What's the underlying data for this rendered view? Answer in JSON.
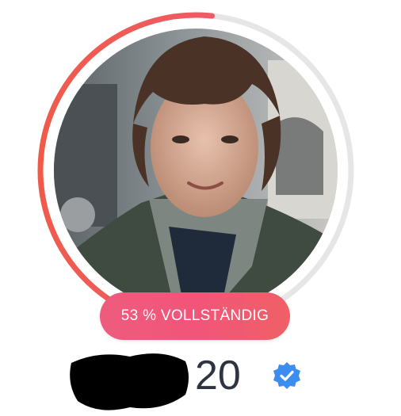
{
  "profile": {
    "completion": {
      "percent": 53,
      "label": "53 % VOLLSTÄNDIG"
    },
    "age": "20",
    "verified_icon": "verified-badge-icon",
    "photo_icon": "profile-photo"
  },
  "colors": {
    "progress_start": "#f0567f",
    "progress_end": "#ee5a4e",
    "track": "#e6e6e6",
    "badge": "#f0557a",
    "verified": "#3d8cf0",
    "text_dark": "#2f3540"
  }
}
